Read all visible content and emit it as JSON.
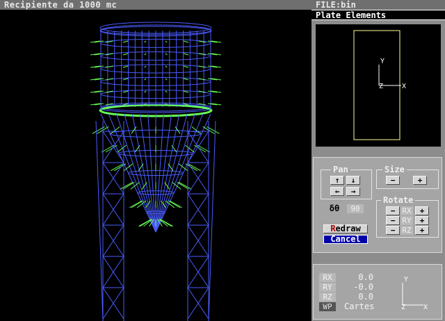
{
  "window": {
    "title": "Recipiente da 1000 mc"
  },
  "panel": {
    "file": "FILE:bin",
    "mode": "Plate Elements"
  },
  "preview": {
    "axis_y": "Y",
    "axis_z": "Z",
    "axis_x": "X"
  },
  "controls": {
    "pan_label": "Pan",
    "size_label": "Size",
    "rotate_label": "Rotate",
    "up_arrow": "↑",
    "down_arrow": "↓",
    "left_arrow": "←",
    "right_arrow": "→",
    "minus": "−",
    "plus": "+",
    "delta_label": "δθ",
    "delta_value": "90",
    "rotate_axes": [
      "RX",
      "RY",
      "RZ"
    ],
    "redraw_hotkey": "R",
    "redraw_rest": "edraw",
    "cancel": "Cancel"
  },
  "status": {
    "rows": [
      {
        "label": "RX",
        "value": "0.0"
      },
      {
        "label": "RY",
        "value": "-0.0"
      },
      {
        "label": "RZ",
        "value": "0.0"
      }
    ],
    "wp_label": "WP",
    "coord_system": "Cartes",
    "axis_y": "Y",
    "axis_z": "Z",
    "axis_x": "X"
  },
  "colors": {
    "wireframe": "#4a5cff",
    "vectors": "#66ff55",
    "frame": "#ffff99",
    "cancel_bg": "#0000aa",
    "hotkey": "#aa0000"
  }
}
